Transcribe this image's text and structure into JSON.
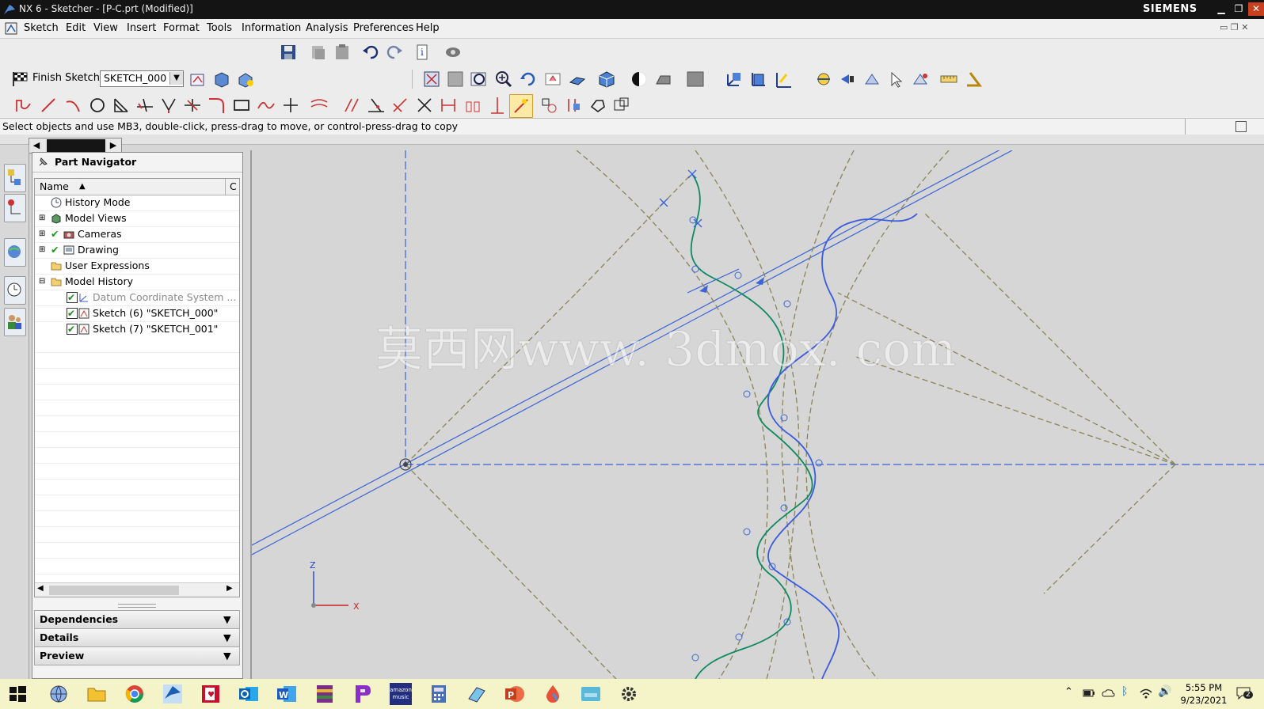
{
  "window": {
    "title": "NX 6 - Sketcher - [P-C.prt (Modified)]",
    "brand": "SIEMENS"
  },
  "menu": [
    "Sketch",
    "Edit",
    "View",
    "Insert",
    "Format",
    "Tools",
    "Information",
    "Analysis",
    "Preferences",
    "Help"
  ],
  "sketch_bar": {
    "finish_label": "Finish Sketch",
    "sketch_name": "SKETCH_000"
  },
  "status_line": "Select objects and use MB3, double-click, press-drag to move, or control-press-drag to copy",
  "navigator": {
    "title": "Part Navigator",
    "col_name": "Name",
    "col_c": "C",
    "items": [
      {
        "label": "History Mode"
      },
      {
        "label": "Model Views"
      },
      {
        "label": "Cameras"
      },
      {
        "label": "Drawing"
      },
      {
        "label": "User Expressions"
      },
      {
        "label": "Model History"
      },
      {
        "label": "Datum Coordinate System ..."
      },
      {
        "label": "Sketch (6) \"SKETCH_000\""
      },
      {
        "label": "Sketch (7) \"SKETCH_001\""
      }
    ],
    "panels": [
      "Dependencies",
      "Details",
      "Preview"
    ]
  },
  "graphics": {
    "watermark": "莫西网www. 3dmox. com",
    "axis_z": "Z",
    "axis_x": "X"
  },
  "taskbar": {
    "time": "5:55 PM",
    "date": "9/23/2021",
    "notification_count": "2",
    "music_label": "amazon music"
  },
  "colors": {
    "curve_green": "#0f8a5f",
    "curve_blue": "#3a5be0",
    "construction": "#8a8456",
    "reference_blue": "#3b64d6"
  }
}
